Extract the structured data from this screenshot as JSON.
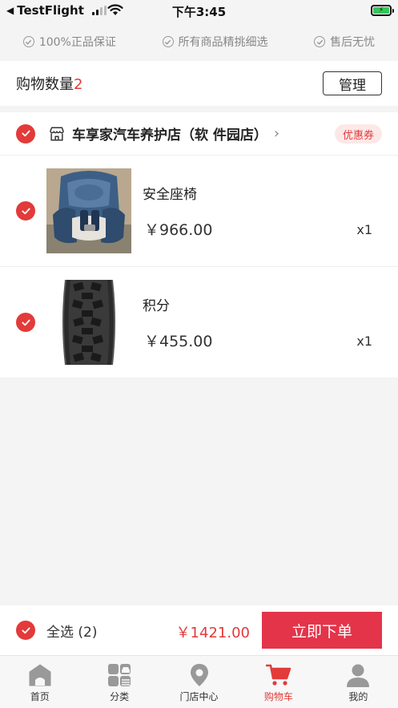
{
  "status_bar": {
    "back_app": "TestFlight",
    "time": "下午3:45"
  },
  "guarantees": [
    {
      "label": "100%正品保证"
    },
    {
      "label": "所有商品精挑细选"
    },
    {
      "label": "售后无忧"
    }
  ],
  "cart_header": {
    "count_label": "购物数量",
    "count": "2",
    "manage_label": "管理"
  },
  "store": {
    "name": "车享家汽车养护店（软 件园店）",
    "coupon_label": "优惠券",
    "checked": true
  },
  "items": [
    {
      "name": "安全座椅",
      "price": "￥966.00",
      "qty": "x1",
      "checked": true,
      "image": "car-seat"
    },
    {
      "name": "积分",
      "price": "￥455.00",
      "qty": "x1",
      "checked": true,
      "image": "tire"
    }
  ],
  "bottom": {
    "select_all_label": "全选 (2)",
    "total": "￥1421.00",
    "order_label": "立即下单"
  },
  "tabs": [
    {
      "label": "首页",
      "icon": "home-icon",
      "active": false
    },
    {
      "label": "分类",
      "icon": "category-icon",
      "active": false
    },
    {
      "label": "门店中心",
      "icon": "location-pin-icon",
      "active": false
    },
    {
      "label": "购物车",
      "icon": "cart-icon",
      "active": true
    },
    {
      "label": "我的",
      "icon": "user-icon",
      "active": false
    }
  ],
  "colors": {
    "accent": "#e33a3a",
    "order_button": "#e3344a",
    "coupon_bg": "#fde8e8",
    "battery": "#34c759"
  }
}
